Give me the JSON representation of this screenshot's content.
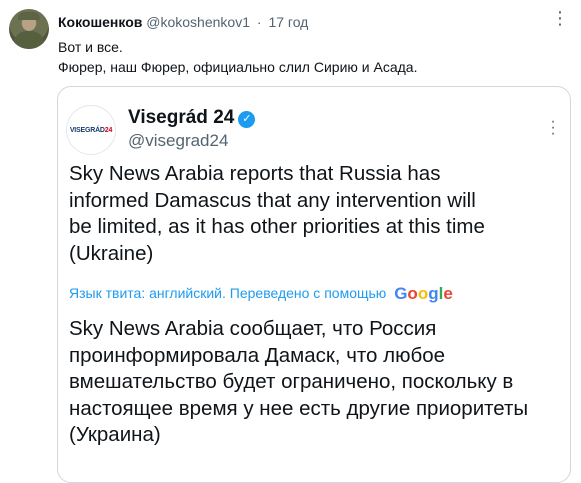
{
  "post": {
    "author_name": "Кокошенков",
    "author_handle": "@kokoshenkov1",
    "separator": "·",
    "time": "17 год",
    "more_glyph": "⋮",
    "lines": [
      "Вот и все.",
      "Фюрер, наш Фюрер, официально слил Сирию и Асада."
    ]
  },
  "quote": {
    "avatar_text_a": "VISEGRÁD",
    "avatar_text_b": "24",
    "name": "Visegrád 24",
    "verified_glyph": "✓",
    "handle": "@visegrad24",
    "text_lines": [
      "Sky News Arabia reports that Russia has",
      "informed Damascus that any intervention will",
      "be limited, as it has other priorities at this time",
      "(Ukraine)"
    ],
    "translate_label": "Язык твита: английский. Переведено с помощью",
    "google_letters": [
      "G",
      "o",
      "o",
      "g",
      "l",
      "e"
    ],
    "translated_lines": [
      "Sky News Arabia сообщает, что Россия",
      "проинформировала Дамаск, что любое",
      "вмешательство будет ограничено, поскольку в",
      "настоящее время у нее есть другие приоритеты",
      "(Украина)"
    ]
  }
}
